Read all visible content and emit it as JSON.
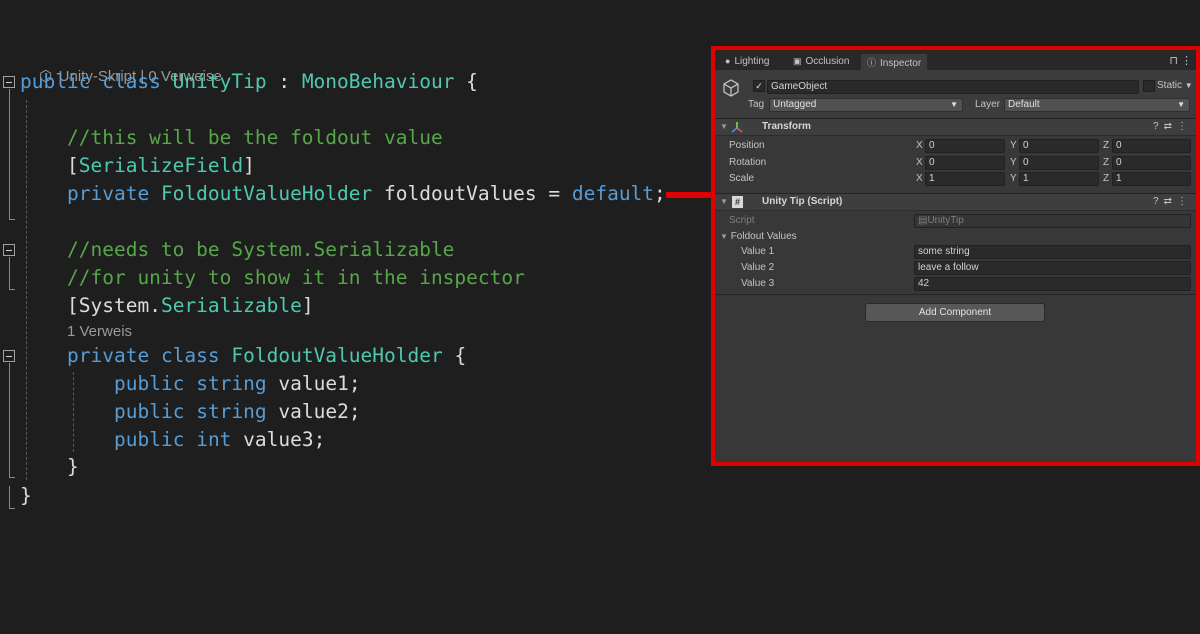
{
  "editor": {
    "code_lens_top": "Unity-Skript | 0 Verweise",
    "code_lens_inner": "1 Verweis",
    "lines": {
      "l1": {
        "kw1": "public",
        "kw2": "class",
        "name": "UnityTip",
        "colon": " : ",
        "base": "MonoBehaviour",
        "brace": " {"
      },
      "l2": {
        "comment": "//this will be the foldout value"
      },
      "l3": {
        "open": "[",
        "attr": "SerializeField",
        "close": "]"
      },
      "l4": {
        "kw": "private",
        "type": "FoldoutValueHolder",
        "name": " foldoutValues = ",
        "value": "default",
        "end": ";"
      },
      "l5": {
        "comment": "//needs to be System.Serializable"
      },
      "l6": {
        "comment": "//for unity to show it in the inspector"
      },
      "l7": {
        "open": "[",
        "ns": "System",
        "dot": ".",
        "attr": "Serializable",
        "close": "]"
      },
      "l8": {
        "kw1": "private",
        "kw2": "class",
        "name": "FoldoutValueHolder",
        "brace": " {"
      },
      "l9": {
        "kw1": "public",
        "kw2": "string",
        "name": " value1;"
      },
      "l10": {
        "kw1": "public",
        "kw2": "string",
        "name": " value2;"
      },
      "l11": {
        "kw1": "public",
        "kw2": "int",
        "name": " value3;"
      },
      "l12": {
        "brace": "}"
      },
      "l13": {
        "brace": "}"
      }
    }
  },
  "inspector": {
    "tabs": [
      {
        "label": "Lighting",
        "icon": "bulb-icon"
      },
      {
        "label": "Occlusion",
        "icon": "occlusion-icon"
      },
      {
        "label": "Inspector",
        "icon": "info-icon",
        "active": true
      }
    ],
    "gameobject": {
      "name": "GameObject",
      "static_label": "Static",
      "tag_label": "Tag",
      "tag_value": "Untagged",
      "layer_label": "Layer",
      "layer_value": "Default"
    },
    "transform": {
      "title": "Transform",
      "rows": [
        {
          "label": "Position",
          "x": "0",
          "y": "0",
          "z": "0"
        },
        {
          "label": "Rotation",
          "x": "0",
          "y": "0",
          "z": "0"
        },
        {
          "label": "Scale",
          "x": "1",
          "y": "1",
          "z": "1"
        }
      ],
      "axis_x": "X",
      "axis_y": "Y",
      "axis_z": "Z"
    },
    "script_component": {
      "title": "Unity Tip (Script)",
      "script_label": "Script",
      "script_value": "UnityTip",
      "foldout_label": "Foldout Values",
      "values": [
        {
          "label": "Value 1",
          "value": "some string"
        },
        {
          "label": "Value 2",
          "value": "leave a follow"
        },
        {
          "label": "Value 3",
          "value": "42"
        }
      ]
    },
    "add_component": "Add Component"
  },
  "colors": {
    "highlight_border": "#e00000",
    "keyword": "#569cd6",
    "type": "#4ec9b0",
    "comment": "#57a64a"
  }
}
